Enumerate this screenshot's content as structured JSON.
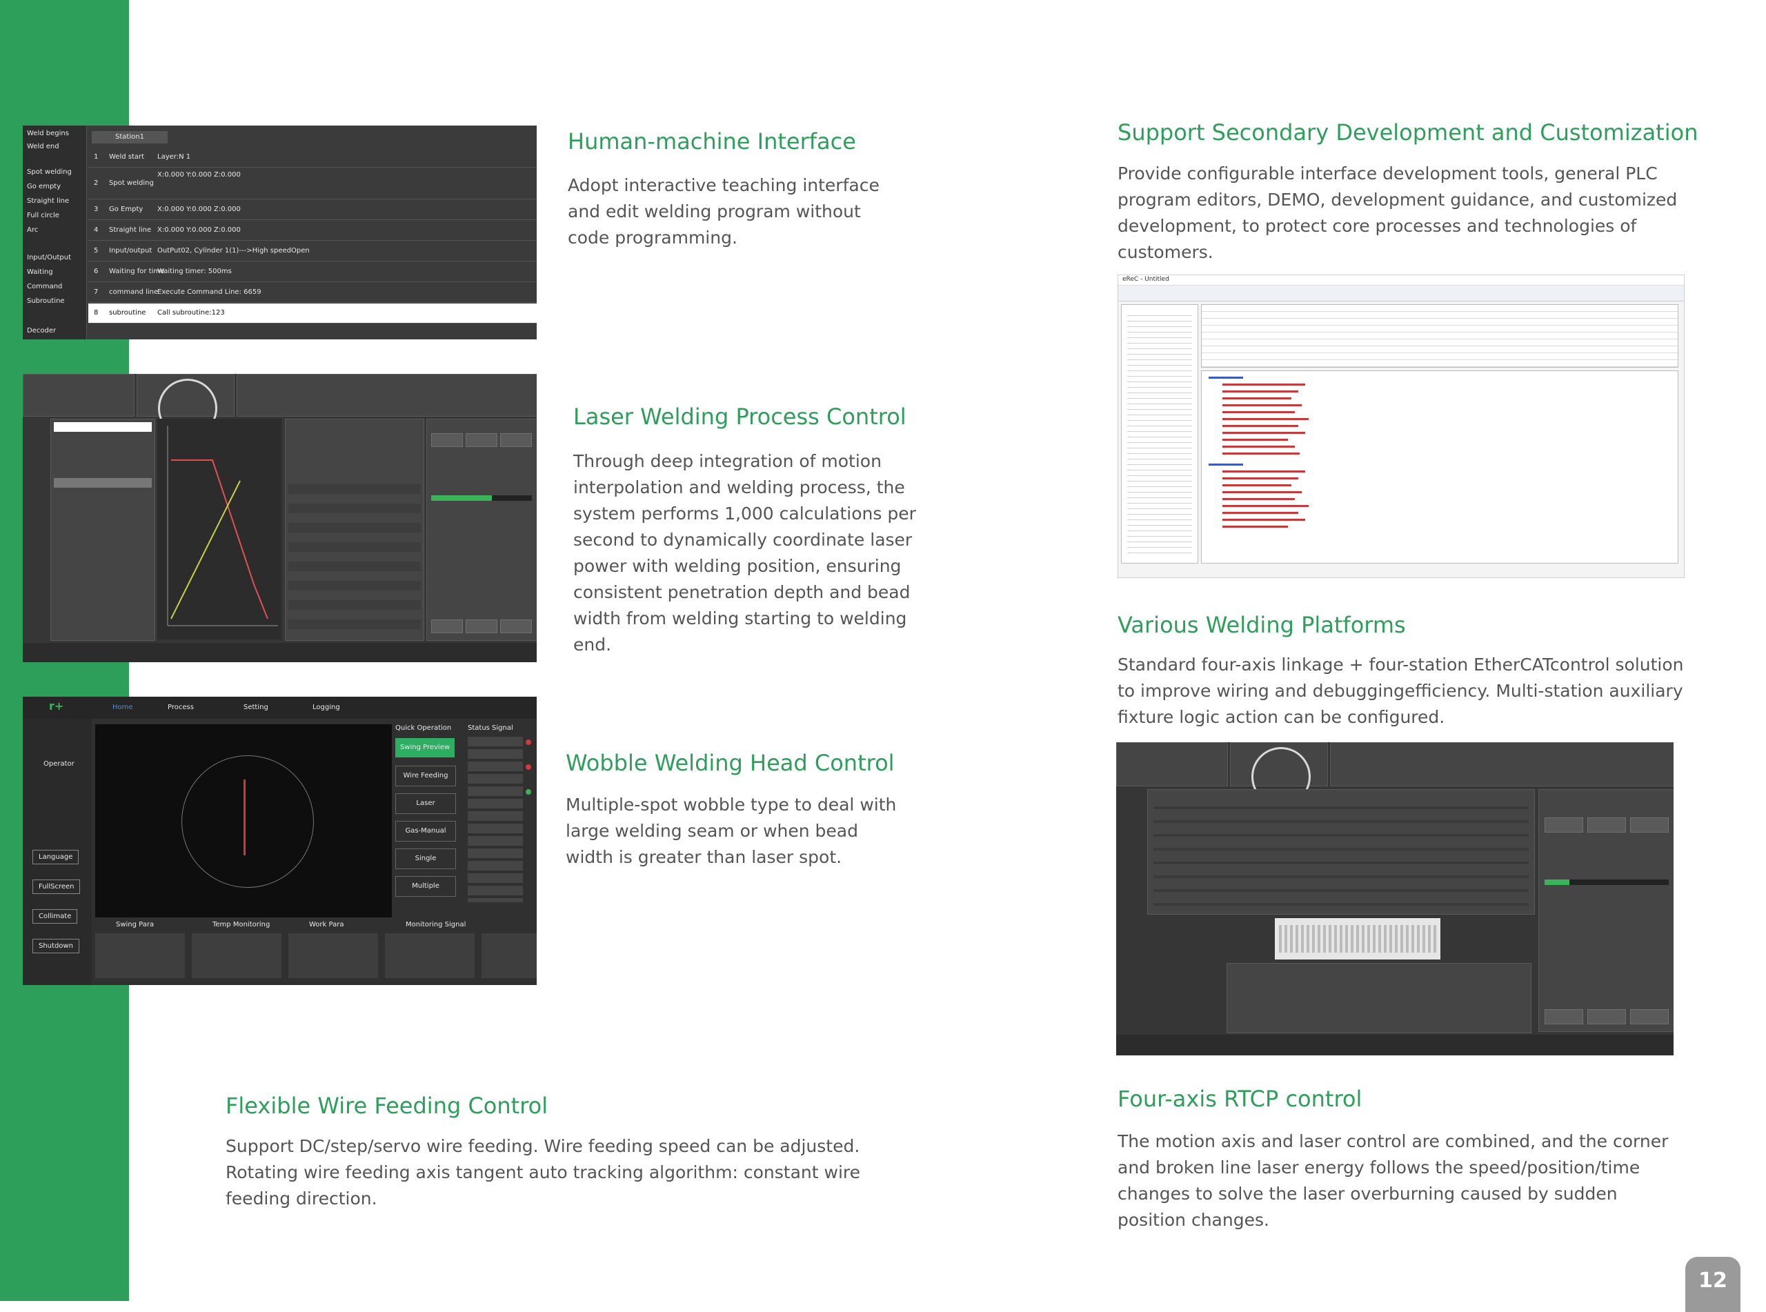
{
  "page_number": "12",
  "sections": {
    "hmi": {
      "title": "Human-machine Interface",
      "body": "Adopt interactive teaching interface and edit welding program without code programming."
    },
    "laser_process": {
      "title": "Laser Welding Process Control",
      "body": "Through deep integration of motion interpolation and welding process, the system performs 1,000 calculations per second to dynamically coordinate laser power with welding position, ensuring consistent penetration depth and bead width from welding starting to welding end."
    },
    "wobble": {
      "title": "Wobble Welding Head Control",
      "body": "Multiple-spot wobble type to deal with large welding seam or when bead width is greater than laser spot."
    },
    "wire_feeding": {
      "title": "Flexible Wire Feeding Control",
      "body": "Support DC/step/servo wire feeding. Wire feeding speed can be adjusted. Rotating wire feeding axis tangent auto tracking algorithm: constant wire feeding direction."
    },
    "secondary_dev": {
      "title": "Support Secondary Development and Customization",
      "body": "Provide configurable interface development tools, general PLC program editors, DEMO, development guidance, and customized development, to protect core processes and technologies of customers."
    },
    "platforms": {
      "title": "Various Welding Platforms",
      "body": "Standard four-axis linkage + four-station EtherCATcontrol solution to improve wiring and debuggingefficiency. Multi-station auxiliary fixture logic action can be configured."
    },
    "rtcp": {
      "title": "Four-axis RTCP control",
      "body": "The motion axis and laser control are combined, and the corner and broken line laser energy follows the speed/position/time changes to solve the laser overburning caused by sudden position changes."
    }
  },
  "screens": {
    "hmi_screen": {
      "sidebar": [
        "Weld begins",
        "Weld end",
        "Spot welding",
        "Go empty",
        "Straight line",
        "Full circle",
        "Arc",
        "Input/Output",
        "Waiting",
        "Command",
        "Subroutine"
      ],
      "tab": "Station1",
      "rows": [
        {
          "n": "1",
          "type": "Weld start",
          "desc": "Layer:N 1"
        },
        {
          "n": "2",
          "type": "Spot welding",
          "desc": "X:0.000 Y:0.000 Z:0.000"
        },
        {
          "n": "3",
          "type": "Go Empty",
          "desc": "X:0.000 Y:0.000 Z:0.000"
        },
        {
          "n": "4",
          "type": "Straight line",
          "desc": "X:0.000 Y:0.000 Z:0.000"
        },
        {
          "n": "5",
          "type": "Input/output",
          "desc": "OutPut02, Cylinder 1(1)--->High speedOpen"
        },
        {
          "n": "6",
          "type": "Waiting for time",
          "desc": "Waiting timer: 500ms"
        },
        {
          "n": "7",
          "type": "command line",
          "desc": "Execute Command Line: 6659"
        },
        {
          "n": "8",
          "type": "subroutine",
          "desc": "Call subroutine:123"
        }
      ],
      "footer": "Decoder"
    },
    "wobble_screen": {
      "nav": [
        "Home",
        "Process",
        "Setting",
        "Logging"
      ],
      "side": [
        "Operator",
        "Language",
        "FullScreen",
        "Collimate",
        "Shutdown"
      ],
      "quick_title": "Quick Operation",
      "status_title": "Status Signal",
      "quick": [
        "Swing Preview",
        "Wire Feeding",
        "Laser",
        "Gas-Manual",
        "Single",
        "Multiple"
      ],
      "bottom": [
        "Swing Para",
        "Temp Monitoring",
        "Work Para",
        "Monitoring Signal"
      ]
    },
    "ide_screen": {
      "title_bar": "eReC - Untitled"
    }
  },
  "colors": {
    "accent_green": "#2e9e5b",
    "body_text": "#555555",
    "page_badge": "#9a9a9a"
  }
}
